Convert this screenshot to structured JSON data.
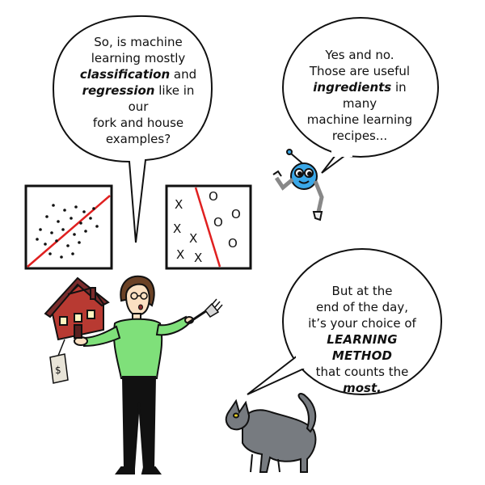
{
  "bubbles": {
    "question": {
      "line1": "So, is machine",
      "line2": "learning mostly",
      "emph1": "classification",
      "line3_rest": " and",
      "emph2": "regression",
      "line4_rest": " like in our",
      "line5": "fork and house",
      "line6": "examples?"
    },
    "robot": {
      "line1": "Yes and no.",
      "line2": "Those are useful",
      "emph": "ingredients",
      "line3_rest": " in many",
      "line4": "machine learning",
      "line5": "recipes..."
    },
    "cat": {
      "line1": "But at the",
      "line2": "end of the day,",
      "line3": "it’s your choice of",
      "emph1": "LEARNING METHOD",
      "line5": "that counts the",
      "emph2": "most."
    }
  },
  "icons": {
    "regression_plot": "scatter-regression-icon",
    "classification_plot": "classification-boundary-icon",
    "house": "house-icon",
    "price_tag": "price-tag-icon",
    "fork": "fork-icon",
    "robot": "robot-icon",
    "cat": "cat-icon",
    "person": "woman-icon"
  },
  "classification_marks": {
    "x_mark": "X",
    "o_mark": "O"
  },
  "colors": {
    "divider_line": "#e02020",
    "shirt": "#7fe07a",
    "robot_body": "#3aa8e8",
    "cat_body": "#777b80",
    "house": "#b83a32",
    "roof": "#7a2c2c",
    "cat_eye": "#e8d020"
  }
}
